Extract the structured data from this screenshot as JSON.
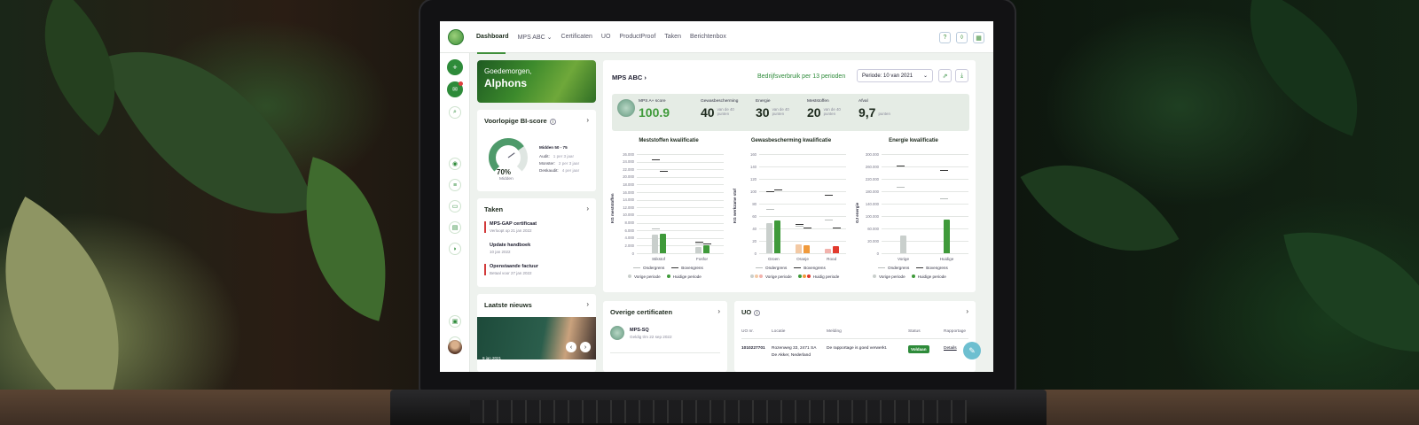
{
  "topbar": {
    "nav": [
      "Dashboard",
      "MPS ABC",
      "Certificaten",
      "UO",
      "ProductProof",
      "Taken",
      "Berichtenbox"
    ]
  },
  "greeting": {
    "line1": "Goedemorgen,",
    "line2": "Alphons"
  },
  "bi_score": {
    "title": "Voorlopige BI-score",
    "percent": "70%",
    "percent_value": 70,
    "level": "Midden",
    "range": "Midden 50 - 75",
    "rows": [
      {
        "label": "Audit:",
        "value": "1 per 3 jaar"
      },
      {
        "label": "Monster:",
        "value": "2 per 3 jaar"
      },
      {
        "label": "Deskaudit:",
        "value": "4 per jaar"
      }
    ]
  },
  "tasks": {
    "title": "Taken",
    "items": [
      {
        "title": "MPS-GAP certificaat",
        "sub": "Verloopt op 21 jan 2022"
      },
      {
        "title": "Update handboek",
        "sub": "10 jan 2022"
      },
      {
        "title": "Openstaande factuur",
        "sub": "Betaal voor 27 jan 2022"
      }
    ]
  },
  "news": {
    "title": "Laatste nieuws",
    "date": "9 jan 2021"
  },
  "mps": {
    "title": "MPS ABC",
    "company_usage": "Bedrijfsverbruik per 13 perioden",
    "period_select": "Periode: 10 van 2021",
    "metrics": [
      {
        "label": "MPS A+ score",
        "value": "100.9",
        "unit": ""
      },
      {
        "label": "Gewasbescherming",
        "value": "40",
        "unit": "van de 40 punten"
      },
      {
        "label": "Energie",
        "value": "30",
        "unit": "van de 40 punten"
      },
      {
        "label": "Meststoffen",
        "value": "20",
        "unit": "van de 40 punten"
      },
      {
        "label": "Afval",
        "value": "9,7",
        "unit": "punten"
      }
    ]
  },
  "colors": {
    "accent": "#3f9a3a",
    "previous": "#c9cfcc",
    "lower": "#b8bdbb",
    "upper": "#333333",
    "red": "#e23b2e",
    "orange": "#f09a3c"
  },
  "chart_data": [
    {
      "type": "bar",
      "title": "Meststoffen kwalificatie",
      "ylabel": "KG meststoffen",
      "ylim": [
        0,
        26000
      ],
      "yticks": [
        "26.000",
        "24.000",
        "22.000",
        "20.000",
        "18.000",
        "16.000",
        "14.000",
        "12.000",
        "10.000",
        "8.000",
        "6.000",
        "4.000",
        "2.000",
        "0"
      ],
      "categories": [
        "Stikstof",
        "Fosfor"
      ],
      "series": [
        {
          "name": "Vorige periode",
          "values": [
            4800,
            1700
          ]
        },
        {
          "name": "Huidige periode",
          "values": [
            5200,
            2000
          ]
        }
      ],
      "ondergrens": [
        6600,
        2600
      ],
      "bovengrens": [
        24700,
        3100
      ],
      "bovengrens_current": [
        21500,
        2500
      ],
      "legend": [
        "Ondergrens",
        "Bovengrens",
        "Vorige periode",
        "Huidige periode"
      ]
    },
    {
      "type": "bar",
      "title": "Gewasbescherming kwalificatie",
      "ylabel": "KG werkzame stof",
      "ylim": [
        0,
        160
      ],
      "yticks": [
        "160",
        "140",
        "120",
        "100",
        "80",
        "60",
        "40",
        "20",
        "0"
      ],
      "categories": [
        "Groen",
        "Oranje",
        "Rood"
      ],
      "series": [
        {
          "name": "Vorige periode",
          "values": [
            48,
            15,
            7
          ]
        },
        {
          "name": "Huidige periode",
          "values": [
            53,
            13,
            11
          ]
        }
      ],
      "ondergrens": [
        72,
        45,
        55
      ],
      "bovengrens": [
        100,
        47,
        95
      ],
      "bovengrens_current": [
        103,
        42,
        42
      ],
      "legend": [
        "Ondergrens",
        "Bovengrens",
        "Vorige periode",
        "Huidig periode"
      ]
    },
    {
      "type": "bar",
      "title": "Energie kwalificatie",
      "ylabel": "GJ energie",
      "ylim": [
        0,
        300000
      ],
      "yticks": [
        "300.000",
        "260.000",
        "220.000",
        "180.000",
        "140.000",
        "100.000",
        "60.000",
        "20.000",
        "0"
      ],
      "categories": [
        "Vorige",
        "Huidige"
      ],
      "series": [
        {
          "name": "Vorige periode",
          "values": [
            54000,
            0
          ]
        },
        {
          "name": "Huidige periode",
          "values": [
            0,
            102000
          ]
        }
      ],
      "ondergrens": [
        200000,
        165000
      ],
      "bovengrens": [
        265000,
        252000
      ],
      "legend": [
        "Ondergrens",
        "Bovengrens",
        "Vorige periode",
        "Huidige periode"
      ]
    }
  ],
  "certificates": {
    "title": "Overige certificaten",
    "item": "MPS-SQ",
    "sub": "Geldig t/m 22 sep 2022"
  },
  "uo": {
    "title": "UO",
    "headers": [
      "UO nr.",
      "Locatie",
      "Melding",
      "Status",
      "Rapportage"
    ],
    "row": {
      "nr": "1010227701",
      "loc1": "Rozenweg 33, 2471 SA",
      "loc2": "De Akker, Nederland",
      "melding": "De rapportage is goed verwerkt.",
      "status": "Voldaan",
      "rapport": "Details"
    }
  }
}
